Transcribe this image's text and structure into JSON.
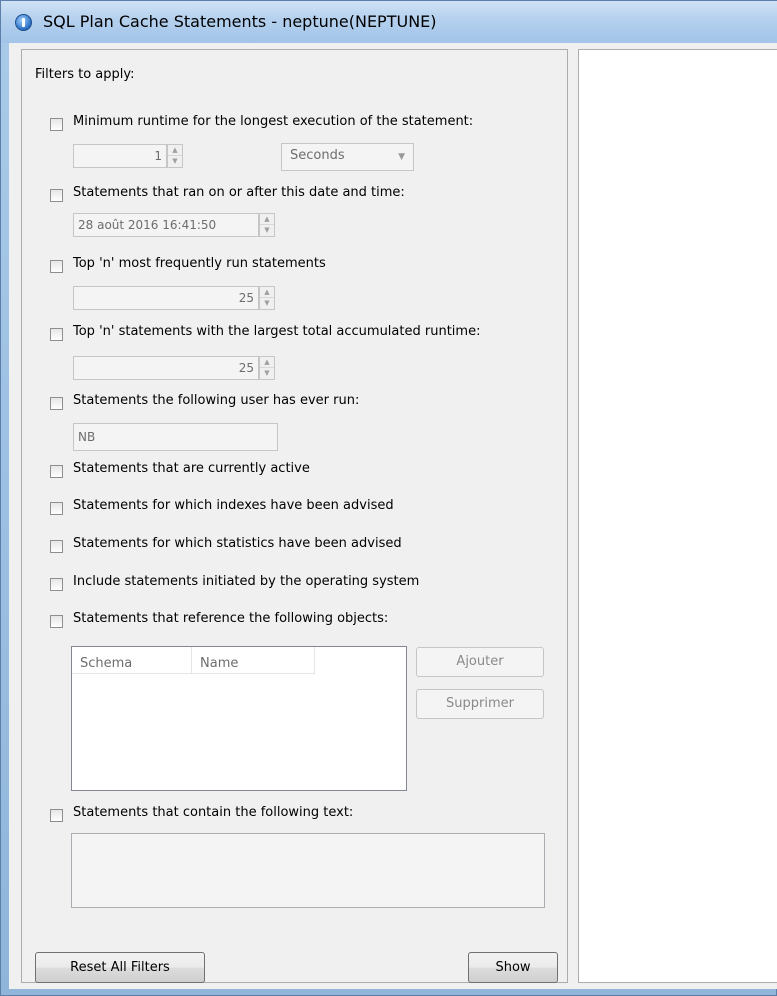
{
  "window": {
    "title": "SQL Plan Cache Statements - neptune(NEPTUNE)"
  },
  "filters": {
    "heading": "Filters to apply:",
    "min_runtime": {
      "label": "Minimum runtime for the longest execution of the statement:",
      "value": "1",
      "unit": "Seconds"
    },
    "ran_after": {
      "label": "Statements that ran on or after this date and time:",
      "value": "28 août 2016 16:41:50"
    },
    "top_frequent": {
      "label": "Top 'n' most frequently run statements",
      "value": "25"
    },
    "top_runtime": {
      "label": "Top 'n' statements with the largest total accumulated runtime:",
      "value": "25"
    },
    "user": {
      "label": "Statements the following user has ever run:",
      "value": "NB"
    },
    "currently_active": {
      "label": "Statements that are currently active"
    },
    "indexes_advised": {
      "label": "Statements for which indexes have been advised"
    },
    "statistics_advised": {
      "label": "Statements for which statistics have been advised"
    },
    "operating_system": {
      "label": "Include statements initiated by the operating system"
    },
    "objects": {
      "label": "Statements that reference the following objects:",
      "columns": [
        "Schema",
        "Name"
      ],
      "add_button": "Ajouter",
      "remove_button": "Supprimer"
    },
    "text": {
      "label": "Statements that contain the following text:",
      "value": ""
    }
  },
  "footer": {
    "reset_button": "Reset All Filters",
    "show_button": "Show"
  }
}
